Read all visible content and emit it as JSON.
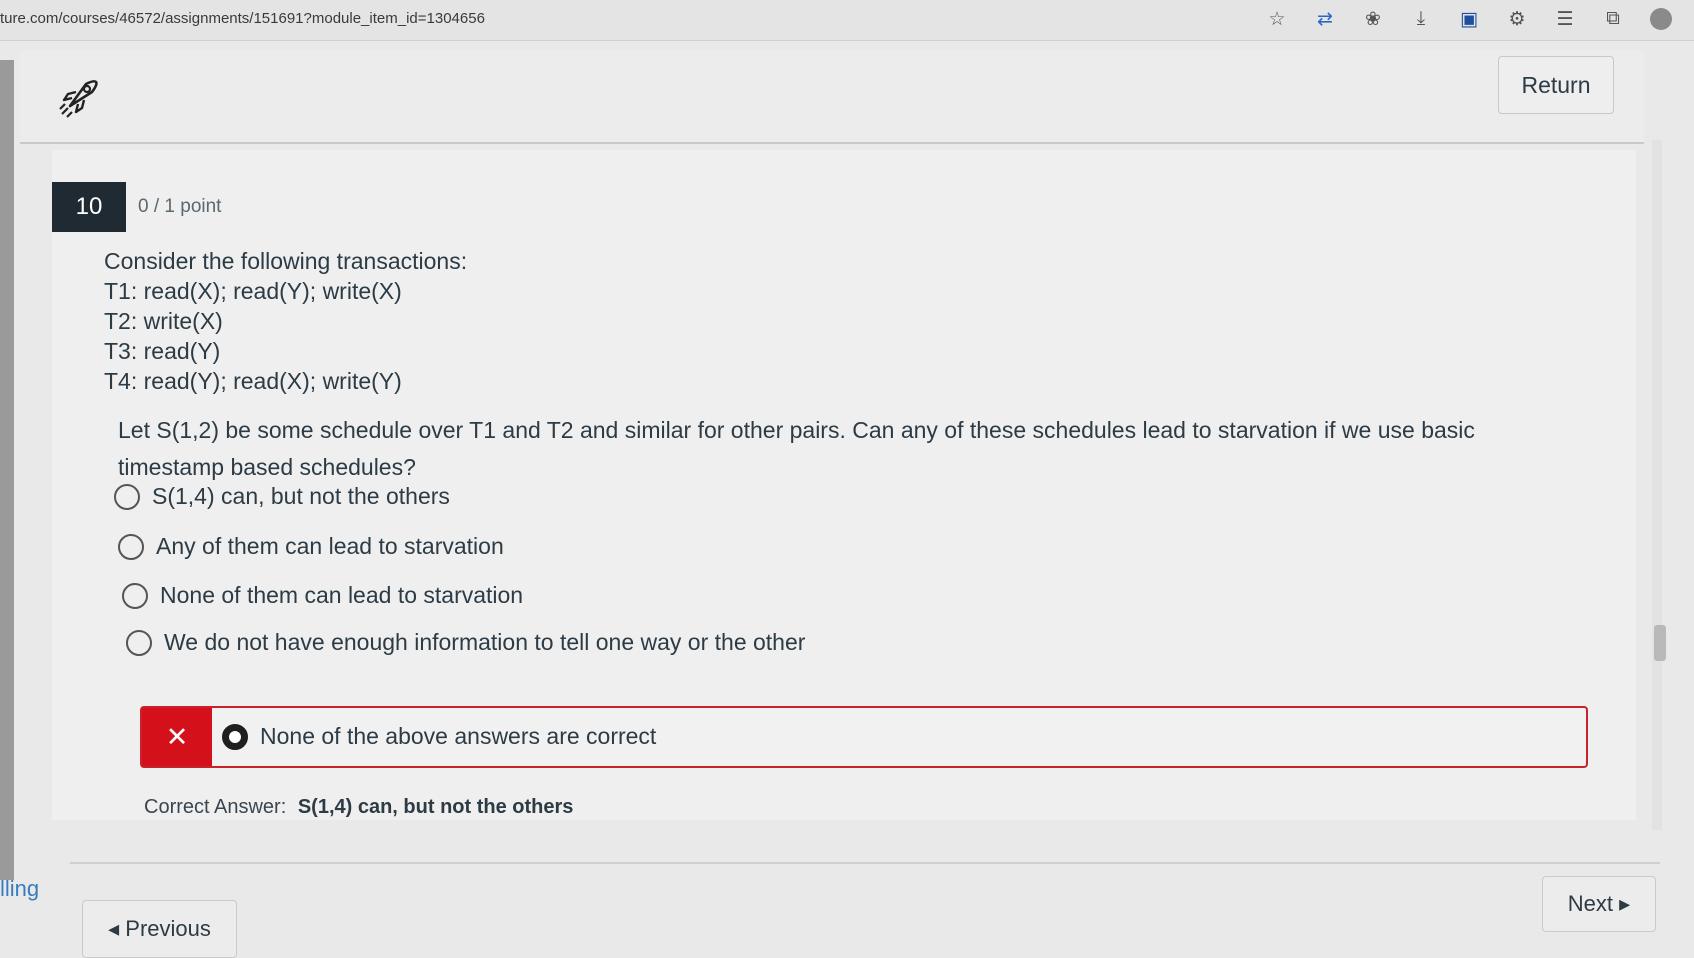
{
  "browser": {
    "url": "ture.com/courses/46572/assignments/151691?module_item_id=1304656",
    "icons": [
      "favorite-star-icon",
      "translate-icon",
      "extension-icon",
      "download-icon",
      "app-icon",
      "puzzle-icon",
      "favorites-list-icon",
      "collections-icon",
      "profile-icon"
    ]
  },
  "header": {
    "logo_icon": "rocket-icon",
    "return_label": "Return"
  },
  "question": {
    "number": "10",
    "points": "0 / 1 point",
    "lines": [
      "Consider the following transactions:",
      "T1: read(X); read(Y); write(X)",
      "T2: write(X)",
      "T3: read(Y)",
      "T4: read(Y); read(X); write(Y)"
    ],
    "prompt": "Let S(1,2) be some schedule over T1 and T2 and similar for other pairs. Can any of these schedules lead to starvation if we use basic timestamp based schedules?",
    "options": [
      "S(1,4) can, but not the others",
      "Any of them can lead to starvation",
      "None of them can lead to starvation",
      "We do not have enough information to tell one way or the other"
    ],
    "selected_wrong_option": "None of the above answers are correct",
    "wrong_mark": "✕",
    "correct_label": "Correct Answer:",
    "correct_value": "S(1,4) can, but not the others"
  },
  "footer": {
    "previous_label": "◂ Previous",
    "next_label": "Next ▸",
    "side_text": "lling"
  },
  "colors": {
    "wrong_accent": "#d4111b",
    "number_badge": "#202a33",
    "text": "#2d3b45"
  }
}
